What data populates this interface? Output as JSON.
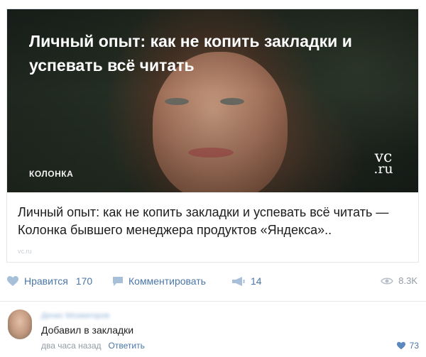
{
  "article": {
    "image_title": "Личный опыт: как не копить закладки и успевать всё читать",
    "image_tag": "КОЛОНКА",
    "logo_top": "vc",
    "logo_bottom": ".ru",
    "link_title": "Личный опыт: как не копить закладки и успевать всё читать — Колонка бывшего менеджера продуктов «Яндекса»..",
    "link_source": "vc.ru"
  },
  "actions": {
    "like_label": "Нравится",
    "like_count": "170",
    "comment_label": "Комментировать",
    "share_count": "14",
    "views_count": "8.3K"
  },
  "comment": {
    "author": "Денис Мозжегоров",
    "text": "Добавил в закладки",
    "time": "два часа назад",
    "reply_label": "Ответить",
    "like_count": "73"
  },
  "colors": {
    "link_blue": "#4a76a8",
    "muted_gray": "#939ba5"
  }
}
